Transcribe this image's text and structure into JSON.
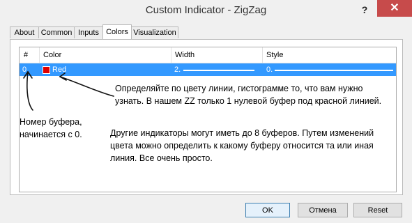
{
  "window": {
    "title": "Custom Indicator - ZigZag",
    "help_glyph": "?",
    "close_glyph": "✕"
  },
  "tabs": [
    {
      "label": "About"
    },
    {
      "label": "Common"
    },
    {
      "label": "Inputs"
    },
    {
      "label": "Colors",
      "active": true
    },
    {
      "label": "Visualization"
    }
  ],
  "grid": {
    "columns": [
      "#",
      "Color",
      "Width",
      "Style"
    ],
    "rows": [
      {
        "index": "0",
        "color_name": "Red",
        "color_hex": "#e00000",
        "width": "2.",
        "style": "0."
      }
    ]
  },
  "annotations": {
    "note1": "Определяйте по цвету линии, гистограмме то, что вам нужно узнать. В нашем ZZ только 1 нулевой буфер под красной линией.",
    "note1_line1": "Определяйте по цвету линии, гистограмме то, что вам нужно",
    "note1_line2": "узнать. В нашем ZZ только 1 нулевой буфер под красной линией.",
    "note2_line1": "Номер буфера,",
    "note2_line2": "начинается с 0.",
    "note3_line1": "Другие индикаторы могут иметь до 8 буферов. Путем изменений",
    "note3_line2": "цвета можно определить к какому буферу относится та или иная",
    "note3_line3": "линия. Все очень просто."
  },
  "buttons": {
    "ok": "OK",
    "cancel": "Отмена",
    "reset": "Reset"
  }
}
